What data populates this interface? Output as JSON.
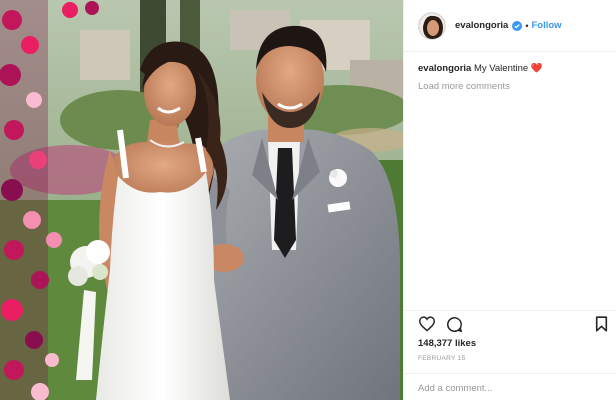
{
  "post": {
    "username": "evalongoria",
    "follow_label": "Follow",
    "separator": "•",
    "caption_user": "evalongoria",
    "caption_text": "My Valentine ❤️",
    "load_more_label": "Load more comments",
    "likes_label": "148,377 likes",
    "date_label": "FEBRUARY 15",
    "comment_placeholder": "Add a comment..."
  },
  "icons": {
    "like": "heart-icon",
    "comment": "comment-icon",
    "save": "bookmark-icon",
    "verified": "verified-badge-icon"
  },
  "colors": {
    "link_blue": "#3897f0",
    "text": "#262626",
    "muted": "#999999",
    "border": "#efefef"
  }
}
